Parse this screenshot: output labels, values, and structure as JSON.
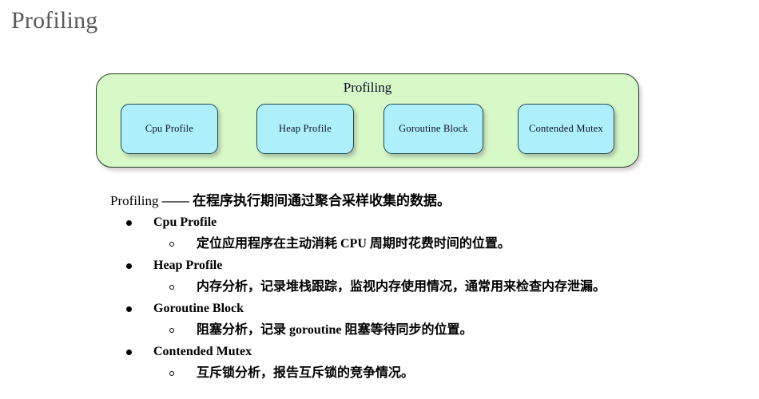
{
  "slide": {
    "title": "Profiling"
  },
  "diagram": {
    "title": "Profiling",
    "colors": {
      "container_fill": "#d6f9c7",
      "container_border": "#1f3d2b",
      "node_fill": "#adf0fc",
      "node_border": "#1f4a4a",
      "title_color": "#0d0d26"
    },
    "nodes": [
      {
        "label": "Cpu Profile"
      },
      {
        "label": "Heap Profile"
      },
      {
        "label": "Goroutine Block"
      },
      {
        "label": "Contended Mutex"
      }
    ]
  },
  "body": {
    "lead_en": "Profiling",
    "lead_zh": " —— 在程序执行期间通过聚合采样收集的数据。",
    "items": [
      {
        "label": "Cpu Profile",
        "detail": "定位应用程序在主动消耗 CPU 周期时花费时间的位置。"
      },
      {
        "label": "Heap Profile",
        "detail": "内存分析，记录堆栈跟踪，监视内存使用情况，通常用来检查内存泄漏。"
      },
      {
        "label": "Goroutine Block",
        "detail": "阻塞分析，记录 goroutine 阻塞等待同步的位置。"
      },
      {
        "label": "Contended Mutex",
        "detail": "互斥锁分析，报告互斥锁的竞争情况。"
      }
    ]
  }
}
